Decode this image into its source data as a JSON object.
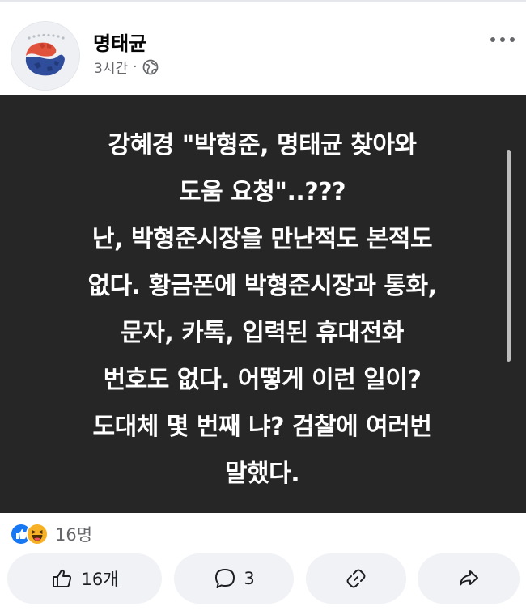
{
  "post": {
    "author": "명태균",
    "time": "3시간",
    "separator": "·",
    "privacy_icon": "globe-icon",
    "lines": [
      "강혜경 \"박형준, 명태균 찾아와",
      "도움 요청\"..???",
      "난, 박형준시장을 만난적도 본적도",
      "없다. 황금폰에 박형준시장과 통화,",
      "문자, 카톡, 입력된 휴대전화",
      "번호도 없다. 어떻게 이런 일이?",
      "도대체 몇 번째 냐? 검찰에 여러번",
      "말했다."
    ],
    "background_color": "#262626"
  },
  "reactions": {
    "icons": [
      "like-icon",
      "haha-icon"
    ],
    "count": "16명"
  },
  "actions": {
    "like_count": "16개",
    "comment_count": "3"
  },
  "colors": {
    "like_blue": "#1877f2",
    "haha_yellow": "#f7b125",
    "meta_gray": "#65676b",
    "button_bg": "#f0f2f5"
  }
}
